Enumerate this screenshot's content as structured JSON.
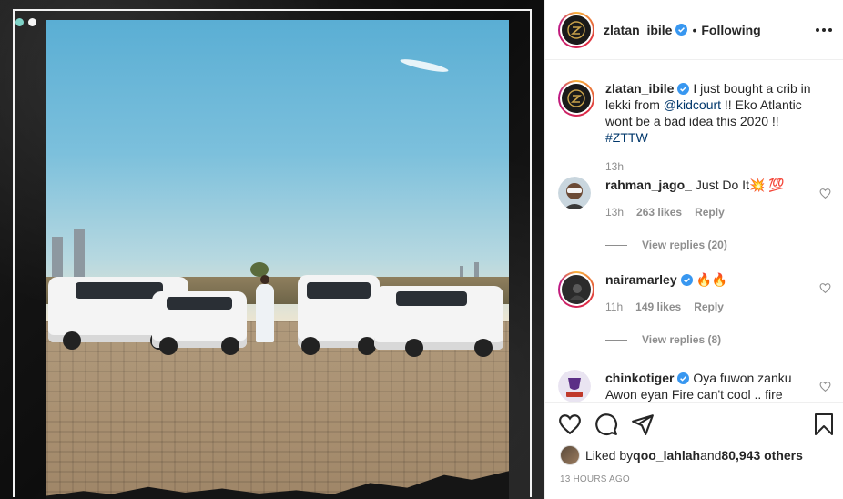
{
  "post": {
    "slide_count": 2,
    "active_slide": 1
  },
  "header": {
    "username": "zlatan_ibile",
    "separator": "•",
    "follow_status": "Following"
  },
  "caption": {
    "username": "zlatan_ibile",
    "text_before_mention": " I just bought a crib in lekki from ",
    "mention": "@kidcourt",
    "text_after_mention": " !! Eko Atlantic wont be a bad idea this 2020 !! ",
    "hashtag": "#ZTTW",
    "time": "13h"
  },
  "comments": [
    {
      "username": "rahman_jago_",
      "verified": false,
      "text": " Just Do It💥 💯",
      "time": "13h",
      "likes": "263 likes",
      "reply_label": "Reply",
      "view_replies": "View replies (20)"
    },
    {
      "username": "nairamarley",
      "verified": true,
      "text": " 🔥🔥",
      "time": "11h",
      "likes": "149 likes",
      "reply_label": "Reply",
      "view_replies": "View replies (8)"
    },
    {
      "username": "chinkotiger",
      "verified": true,
      "text": " Oya fuwon zanku Awon eyan Fire can't cool .. fire"
    }
  ],
  "likes": {
    "prefix": "Liked by ",
    "first_liker": "qoo_lahlah",
    "joiner": " and ",
    "others": "80,943 others"
  },
  "timestamp": "13 HOURS AGO",
  "colors": {
    "verified_blue": "#3897f0",
    "link_blue": "#00376b",
    "muted_gray": "#8e8e8e",
    "active_dot": "#7fd3c8"
  },
  "icons": [
    "verified-badge-icon",
    "more-options-icon",
    "heart-icon",
    "comment-icon",
    "share-icon",
    "bookmark-icon"
  ]
}
